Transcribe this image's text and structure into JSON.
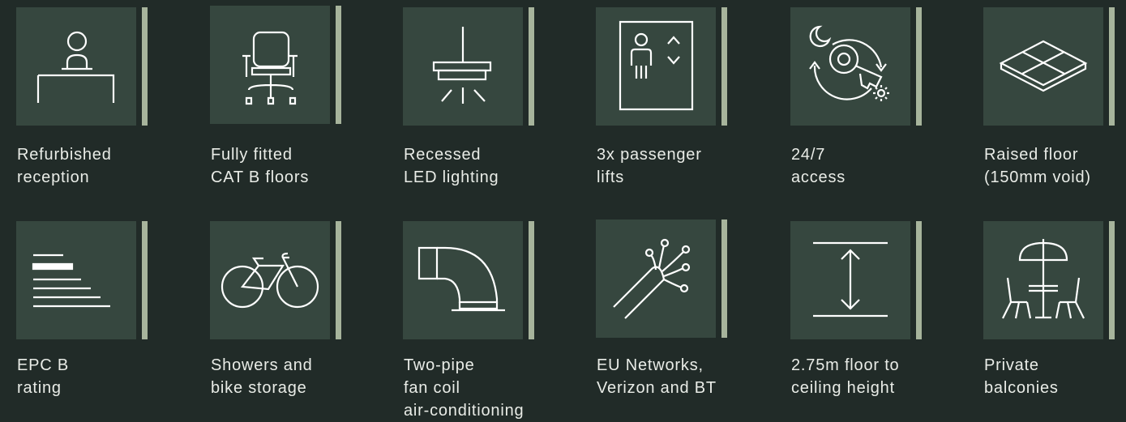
{
  "features": [
    {
      "id": "reception",
      "icon": "reception-desk-icon",
      "lines": [
        "Refurbished",
        "reception"
      ]
    },
    {
      "id": "cat-b",
      "icon": "office-chair-icon",
      "lines": [
        "Fully fitted",
        "CAT B floors"
      ]
    },
    {
      "id": "led",
      "icon": "ceiling-light-icon",
      "lines": [
        "Recessed",
        "LED lighting"
      ]
    },
    {
      "id": "lifts",
      "icon": "passenger-lift-icon",
      "lines": [
        "3x passenger",
        "lifts"
      ]
    },
    {
      "id": "access",
      "icon": "day-night-key-icon",
      "lines": [
        "24/7",
        "access"
      ]
    },
    {
      "id": "raised-floor",
      "icon": "raised-floor-icon",
      "lines": [
        "Raised floor",
        "(150mm void)"
      ]
    },
    {
      "id": "epc",
      "icon": "epc-rating-bars-icon",
      "lines": [
        "EPC B",
        "rating"
      ]
    },
    {
      "id": "bikes",
      "icon": "bicycle-icon",
      "lines": [
        "Showers and",
        "bike storage"
      ]
    },
    {
      "id": "aircon",
      "icon": "air-duct-icon",
      "lines": [
        "Two-pipe",
        "fan coil",
        "air-conditioning"
      ]
    },
    {
      "id": "networks",
      "icon": "fibre-optic-cable-icon",
      "lines": [
        "EU Networks,",
        "Verizon and BT"
      ]
    },
    {
      "id": "ceiling",
      "icon": "ceiling-height-icon",
      "lines": [
        "2.75m floor to",
        "ceiling height"
      ]
    },
    {
      "id": "balconies",
      "icon": "patio-table-umbrella-icon",
      "lines": [
        "Private",
        "balconies"
      ]
    }
  ],
  "colors": {
    "background": "#212b28",
    "tile": "#36473f",
    "accent": "#a7b49c",
    "text": "#e9ece7",
    "icon_stroke": "#ffffff"
  }
}
